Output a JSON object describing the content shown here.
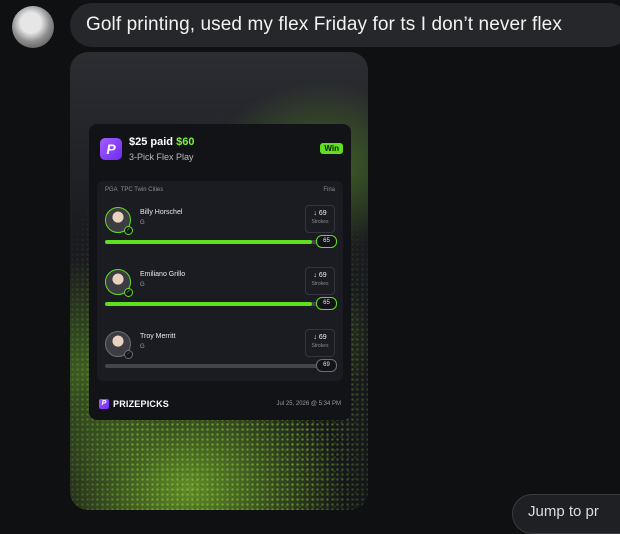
{
  "message": {
    "text": "Golf printing, used my flex Friday for ts I don’t never flex"
  },
  "card": {
    "paid": "$25 paid",
    "won": "$60",
    "play_type": "3-Pick Flex Play",
    "badge": "Win",
    "league": "PGA",
    "event": "TPC Twin Cities",
    "final_label": "Fina",
    "players": [
      {
        "name": "Billy Horschel",
        "pos": "G",
        "projection": "↓ 69",
        "unit": "Strokes",
        "result": "65",
        "progress": 0.94,
        "status": "hit"
      },
      {
        "name": "Emiliano Grillo",
        "pos": "G",
        "projection": "↓ 69",
        "unit": "Strokes",
        "result": "65",
        "progress": 0.94,
        "status": "hit"
      },
      {
        "name": "Troy Merritt",
        "pos": "G",
        "projection": "↓ 69",
        "unit": "Strokes",
        "result": "69",
        "progress": 0.0,
        "status": "push"
      }
    ],
    "brand": "PRIZEPICKS",
    "timestamp": "Jul 25, 2026 @ 5:34 PM",
    "colors": {
      "accent": "#5fe01e",
      "brand": "#8a3cff"
    }
  },
  "jump": {
    "label": "Jump to pr"
  }
}
